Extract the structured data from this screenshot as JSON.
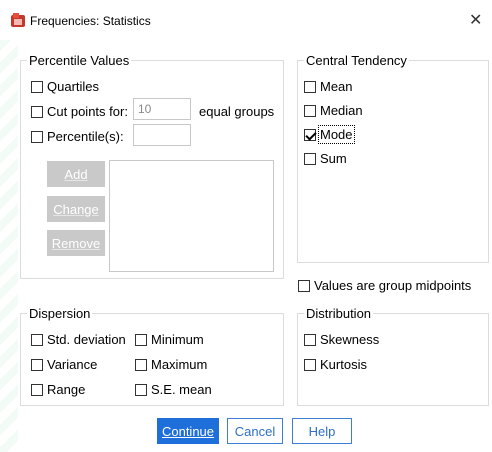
{
  "window": {
    "title": "Frequencies: Statistics",
    "close_glyph": "✕",
    "icon": "spss-app-icon"
  },
  "percentile": {
    "legend": "Percentile Values",
    "quartiles": "Quartiles",
    "cutpoints_label": "Cut points for:",
    "cutpoints_value": "10",
    "cutpoints_suffix": "equal groups",
    "percentiles_label": "Percentile(s):",
    "percentiles_value": "",
    "add": "Add",
    "change": "Change",
    "remove": "Remove"
  },
  "central": {
    "legend": "Central Tendency",
    "mean": "Mean",
    "median": "Median",
    "mode": "Mode",
    "sum": "Sum"
  },
  "midpoints": "Values are group midpoints",
  "dispersion": {
    "legend": "Dispersion",
    "std": "Std. deviation",
    "variance": "Variance",
    "range": "Range",
    "minimum": "Minimum",
    "maximum": "Maximum",
    "se_mean": "S.E. mean"
  },
  "distribution": {
    "legend": "Distribution",
    "skewness": "Skewness",
    "kurtosis": "Kurtosis"
  },
  "buttons": {
    "continue": "Continue",
    "cancel": "Cancel",
    "help": "Help"
  },
  "colors": {
    "primary": "#1e6fd9",
    "disabled": "#c9c9c9"
  }
}
